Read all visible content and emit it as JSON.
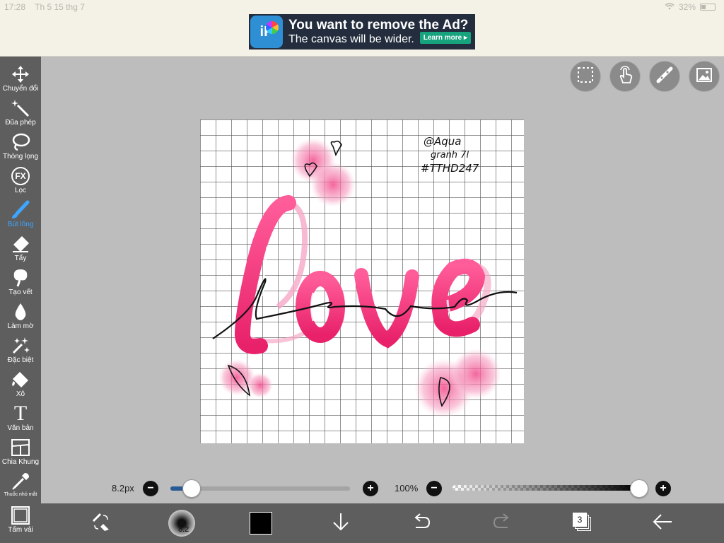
{
  "status_bar": {
    "time": "17:28",
    "date": "Th 5 15 thg 7",
    "battery": "32%",
    "battery_level": 0.32
  },
  "ad": {
    "title": "You want to remove the Ad?",
    "subtitle": "The canvas will be wider.",
    "button": "Learn more ▸",
    "logo_text": "iP"
  },
  "tools": [
    {
      "label": "Chuyển đổi",
      "icon": "move-icon",
      "active": false
    },
    {
      "label": "Đũa phép",
      "icon": "magic-wand-icon",
      "active": false
    },
    {
      "label": "Thòng lọng",
      "icon": "lasso-icon",
      "active": false
    },
    {
      "label": "Lọc",
      "icon": "filter-fx-icon",
      "icon_text": "FX",
      "active": false
    },
    {
      "label": "Bút lông",
      "icon": "brush-icon",
      "active": true
    },
    {
      "label": "Tẩy",
      "icon": "eraser-icon",
      "active": false
    },
    {
      "label": "Tạo vết",
      "icon": "smudge-icon",
      "active": false
    },
    {
      "label": "Làm mờ",
      "icon": "blur-drop-icon",
      "active": false
    },
    {
      "label": "Đặc biệt",
      "icon": "special-sparkle-icon",
      "active": false
    },
    {
      "label": "Xô",
      "icon": "bucket-fill-icon",
      "active": false
    },
    {
      "label": "Văn bản",
      "icon": "text-icon",
      "icon_text": "T",
      "active": false
    },
    {
      "label": "Chia Khung",
      "icon": "frame-divider-icon",
      "active": false
    },
    {
      "label": "Thuốc nhỏ mắt",
      "icon": "eyedropper-icon",
      "active": false
    },
    {
      "label": "Tấm vải",
      "icon": "canvas-icon",
      "active": false
    }
  ],
  "top_buttons": [
    "selection-icon",
    "touch-gesture-icon",
    "ruler-icon",
    "reference-image-icon"
  ],
  "canvas": {
    "signature_line1": "@Aqua",
    "signature_line2": "granh 7l",
    "signature_line3": "#TTHD247",
    "word": "love"
  },
  "brush_size": {
    "label": "8.2px",
    "value": 8.2,
    "fraction": 0.12
  },
  "opacity": {
    "label": "100%",
    "value": 100
  },
  "bottom": {
    "brush_preview_label": "8.2",
    "layers_count": "3",
    "color": "#000000"
  },
  "colors": {
    "toolbar": "#5e5e5e",
    "active": "#3ea6ff",
    "canvas_bg": "#bdbdbd",
    "pink": "#f0317a"
  }
}
